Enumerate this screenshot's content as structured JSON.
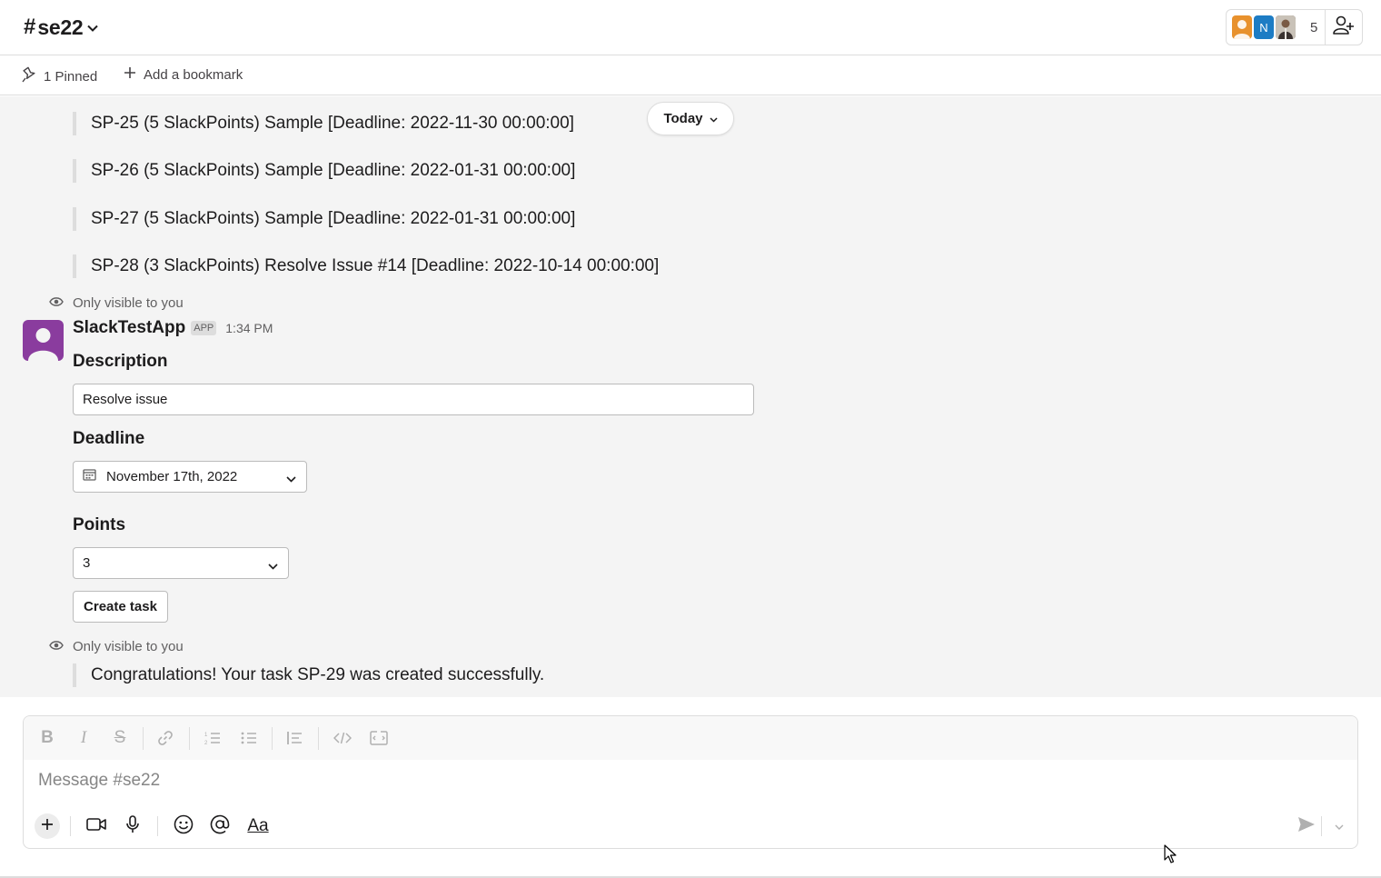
{
  "header": {
    "hash": "#",
    "channel": "se22",
    "member_count": "5",
    "member_avatars": [
      {
        "kind": "photo",
        "color": "#e8912d"
      },
      {
        "kind": "initial",
        "text": "N",
        "color": "#1d7cc4"
      },
      {
        "kind": "photo",
        "color": "#5a4b42"
      }
    ]
  },
  "bookmarks": {
    "pinned_label": "1 Pinned",
    "add_label": "Add a bookmark"
  },
  "messages": {
    "today_label": "Today",
    "task_lines": [
      "SP-25 (5 SlackPoints) Sample [Deadline: 2022-11-30 00:00:00]",
      "SP-26 (5 SlackPoints) Sample [Deadline: 2022-01-31 00:00:00]",
      "SP-27 (5 SlackPoints) Sample [Deadline: 2022-01-31 00:00:00]",
      "SP-28 (3 SlackPoints) Resolve Issue #14 [Deadline: 2022-10-14 00:00:00]"
    ],
    "visible_note": "Only visible to you",
    "bot": {
      "name": "SlackTestApp",
      "badge": "APP",
      "time": "1:34 PM",
      "avatar_color": "#8a3c9e"
    },
    "form": {
      "description_label": "Description",
      "description_value": "Resolve issue",
      "deadline_label": "Deadline",
      "deadline_value": "November 17th, 2022",
      "points_label": "Points",
      "points_value": "3",
      "create_button": "Create task"
    },
    "visible_note_2": "Only visible to you",
    "confirmation": "Congratulations! Your task SP-29 was created successfully."
  },
  "composer": {
    "placeholder": "Message #se22",
    "format_tools": [
      "bold-icon",
      "italic-icon",
      "strikethrough-icon",
      "link-icon",
      "ordered-list-icon",
      "bulleted-list-icon",
      "blockquote-icon",
      "code-icon",
      "code-block-icon"
    ],
    "actions": [
      "plus-icon",
      "video-icon",
      "microphone-icon",
      "emoji-icon",
      "mention-icon",
      "text-format-icon",
      "send-icon"
    ],
    "format_label": "Aa"
  }
}
